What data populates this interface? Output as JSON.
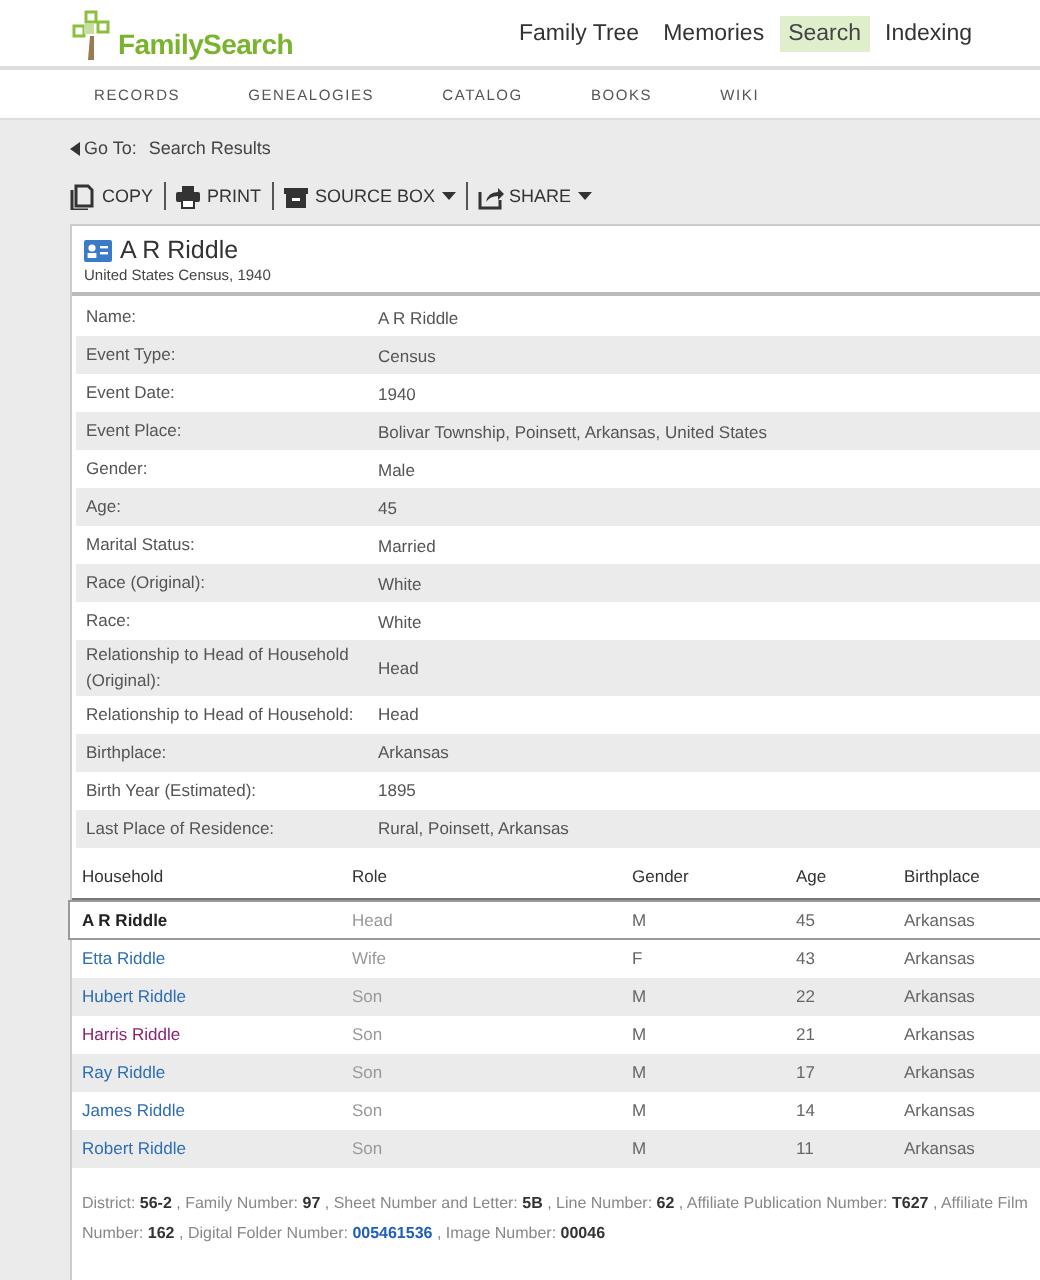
{
  "header": {
    "logo": "FamilySearch",
    "nav": [
      {
        "label": "Family Tree",
        "selected": false
      },
      {
        "label": "Memories",
        "selected": false
      },
      {
        "label": "Search",
        "selected": true
      },
      {
        "label": "Indexing",
        "selected": false
      }
    ]
  },
  "subnav": [
    "RECORDS",
    "GENEALOGIES",
    "CATALOG",
    "BOOKS",
    "WIKI"
  ],
  "goto": {
    "label": "Go To:",
    "link": "Search Results"
  },
  "toolbar": [
    {
      "label": "COPY",
      "kind": "copy"
    },
    {
      "label": "PRINT",
      "kind": "print"
    },
    {
      "label": "SOURCE BOX",
      "kind": "sourcebox"
    },
    {
      "label": "SHARE",
      "kind": "share"
    }
  ],
  "record": {
    "name": "A R Riddle",
    "collection": "United States Census, 1940"
  },
  "facts": [
    {
      "label": "Name:",
      "value": "A R Riddle"
    },
    {
      "label": "Event Type:",
      "value": "Census"
    },
    {
      "label": "Event Date:",
      "value": "1940"
    },
    {
      "label": "Event Place:",
      "value": "Bolivar Township, Poinsett, Arkansas, United States"
    },
    {
      "label": "Gender:",
      "value": "Male"
    },
    {
      "label": "Age:",
      "value": "45"
    },
    {
      "label": "Marital Status:",
      "value": "Married"
    },
    {
      "label": "Race (Original):",
      "value": "White"
    },
    {
      "label": "Race:",
      "value": "White"
    },
    {
      "label": "Relationship to Head of Household (Original):",
      "value": "Head"
    },
    {
      "label": "Relationship to Head of Household:",
      "value": "Head"
    },
    {
      "label": "Birthplace:",
      "value": "Arkansas"
    },
    {
      "label": "Birth Year (Estimated):",
      "value": "1895"
    },
    {
      "label": "Last Place of Residence:",
      "value": "Rural, Poinsett, Arkansas"
    }
  ],
  "household": {
    "columns": [
      "Household",
      "Role",
      "Gender",
      "Age",
      "Birthplace"
    ],
    "rows": [
      {
        "name": "A R Riddle",
        "kind": "current",
        "selected": true,
        "role": "Head",
        "gender": "M",
        "age": "45",
        "birthplace": "Arkansas"
      },
      {
        "name": "Etta Riddle",
        "kind": "link",
        "selected": false,
        "role": "Wife",
        "gender": "F",
        "age": "43",
        "birthplace": "Arkansas"
      },
      {
        "name": "Hubert Riddle",
        "kind": "link",
        "selected": false,
        "role": "Son",
        "gender": "M",
        "age": "22",
        "birthplace": "Arkansas"
      },
      {
        "name": "Harris Riddle",
        "kind": "visited",
        "selected": false,
        "role": "Son",
        "gender": "M",
        "age": "21",
        "birthplace": "Arkansas"
      },
      {
        "name": "Ray Riddle",
        "kind": "link",
        "selected": false,
        "role": "Son",
        "gender": "M",
        "age": "17",
        "birthplace": "Arkansas"
      },
      {
        "name": "James Riddle",
        "kind": "link",
        "selected": false,
        "role": "Son",
        "gender": "M",
        "age": "14",
        "birthplace": "Arkansas"
      },
      {
        "name": "Robert Riddle",
        "kind": "link",
        "selected": false,
        "role": "Son",
        "gender": "M",
        "age": "11",
        "birthplace": "Arkansas"
      }
    ]
  },
  "citation": [
    {
      "label": "District:",
      "value": "56-2",
      "kind": "text",
      "sep": ","
    },
    {
      "label": "Family Number:",
      "value": "97",
      "kind": "text",
      "sep": ","
    },
    {
      "label": "Sheet Number and Letter:",
      "value": "5B",
      "kind": "text",
      "sep": ","
    },
    {
      "label": "Line Number:",
      "value": "62",
      "kind": "text",
      "sep": ","
    },
    {
      "label": "Affiliate Publication Number:",
      "value": "T627",
      "kind": "text",
      "sep": ","
    },
    {
      "label": "Affiliate Film Number:",
      "value": "162",
      "kind": "text",
      "sep": ","
    },
    {
      "label": "Digital Folder Number:",
      "value": "005461536",
      "kind": "link",
      "sep": ","
    },
    {
      "label": "Image Number:",
      "value": "00046",
      "kind": "text"
    }
  ]
}
